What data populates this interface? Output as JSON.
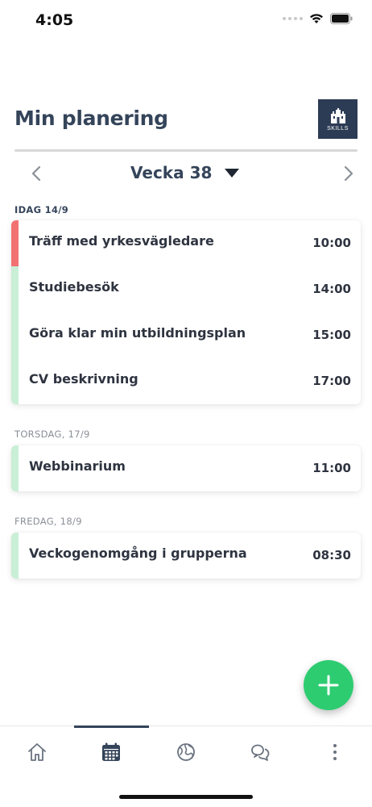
{
  "status_bar": {
    "time": "4:05"
  },
  "header": {
    "title": "Min planering",
    "logo_text": "SKILLS"
  },
  "week_nav": {
    "label": "Vecka 38"
  },
  "days": [
    {
      "heading": "IDAG 14/9",
      "events": [
        {
          "title": "Träff med yrkesvägledare",
          "time": "10:00",
          "stripe_color": "#f27272"
        },
        {
          "title": "Studiebesök",
          "time": "14:00",
          "stripe_color": "#c9efd6"
        },
        {
          "title": "Göra klar min utbildningsplan",
          "time": "15:00",
          "stripe_color": "#c9efd6"
        },
        {
          "title": "CV beskrivning",
          "time": "17:00",
          "stripe_color": "#c9efd6"
        }
      ]
    },
    {
      "heading": "TORSDAG, 17/9",
      "events": [
        {
          "title": "Webbinarium",
          "time": "11:00",
          "stripe_color": "#c9efd6"
        }
      ]
    },
    {
      "heading": "FREDAG, 18/9",
      "events": [
        {
          "title": "Veckogenomgång i grupperna",
          "time": "08:30",
          "stripe_color": "#c9efd6"
        }
      ]
    }
  ],
  "colors": {
    "accent": "#2ecc71",
    "primary": "#34445a"
  },
  "tabs": [
    {
      "icon": "home-icon",
      "active": false
    },
    {
      "icon": "calendar-icon",
      "active": true
    },
    {
      "icon": "globe-icon",
      "active": false
    },
    {
      "icon": "chat-icon",
      "active": false
    },
    {
      "icon": "more-icon",
      "active": false
    }
  ]
}
